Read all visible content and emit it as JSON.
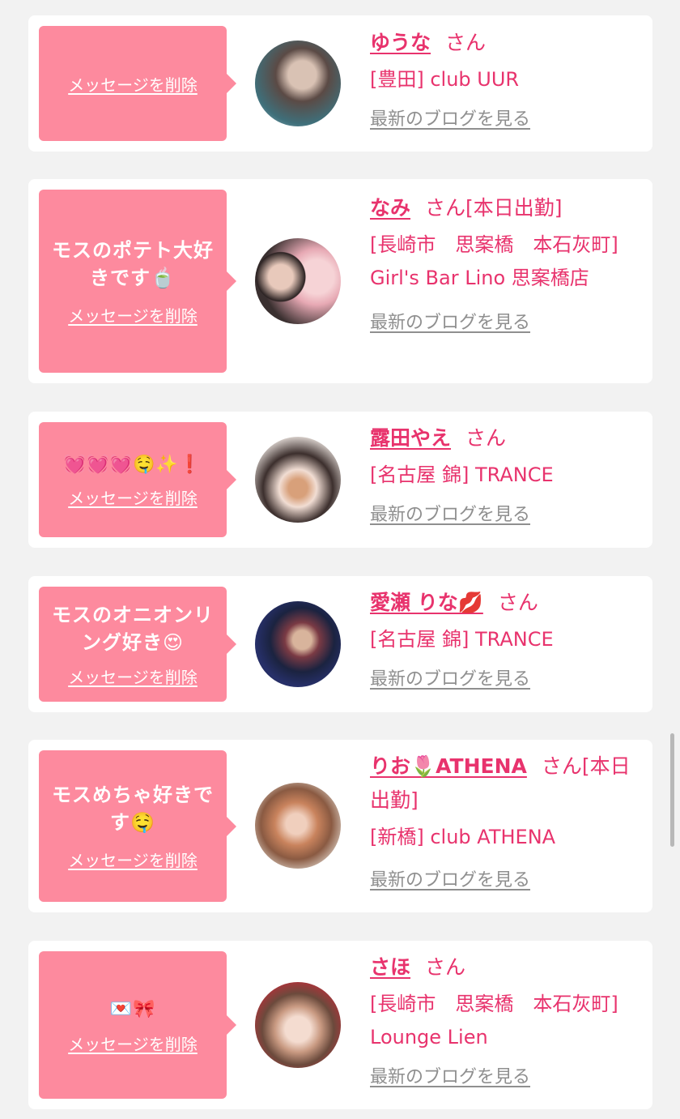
{
  "favorites": [
    {
      "message": "",
      "delete_label": "メッセージを削除",
      "name": "ゆうな",
      "honorific": "さん",
      "status": "",
      "shop": "[豊田] club UUR",
      "blog_link": "最新のブログを見る"
    },
    {
      "message": "モスのポテト大好きです🍵",
      "delete_label": "メッセージを削除",
      "name": "なみ",
      "honorific": "さん",
      "status": "[本日出勤]",
      "shop": "[長崎市　思案橋　本石灰町] Girl's Bar Lino 思案橋店",
      "blog_link": "最新のブログを見る"
    },
    {
      "message": "💓💓💓🤤✨❗",
      "delete_label": "メッセージを削除",
      "name": "露田やえ",
      "honorific": "さん",
      "status": "",
      "shop": "[名古屋 錦] TRANCE",
      "blog_link": "最新のブログを見る"
    },
    {
      "message": "モスのオニオンリング好き😍",
      "delete_label": "メッセージを削除",
      "name": "愛瀬 りな💋",
      "honorific": "さん",
      "status": "",
      "shop": "[名古屋 錦] TRANCE",
      "blog_link": "最新のブログを見る"
    },
    {
      "message": "モスめちゃ好きです🤤",
      "delete_label": "メッセージを削除",
      "name": "りお🌷ATHENA",
      "honorific": "さん",
      "status": "[本日出勤]",
      "shop": "[新橋] club ATHENA",
      "blog_link": "最新のブログを見る"
    },
    {
      "message": "💌🎀",
      "delete_label": "メッセージを削除",
      "name": "さほ",
      "honorific": "さん",
      "status": "",
      "shop": "[長崎市　思案橋　本石灰町] Lounge Lien",
      "blog_link": "最新のブログを見る"
    }
  ],
  "colors": {
    "accent_pink": "#e8336d",
    "bubble_pink": "#fd8a9e",
    "link_gray": "#8f8f8f",
    "background": "#f2f2f2"
  }
}
